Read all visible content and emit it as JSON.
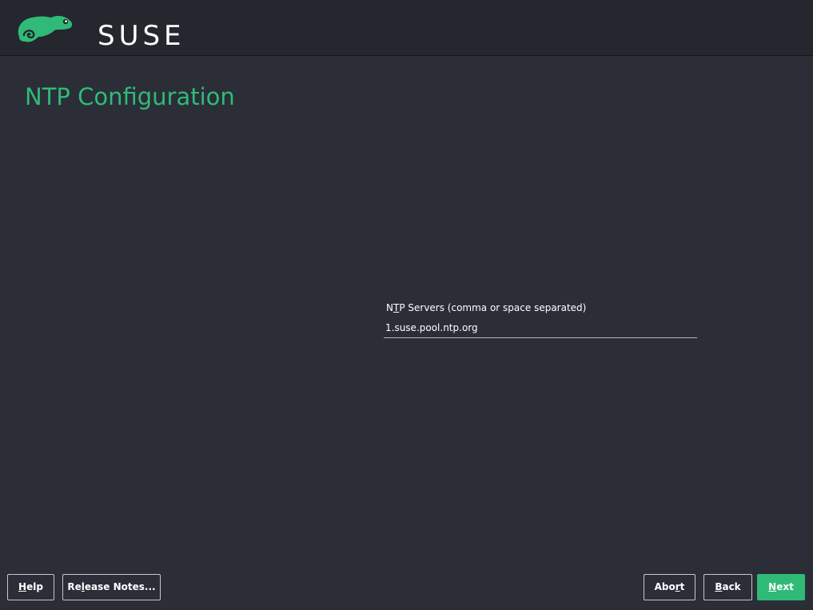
{
  "brand": {
    "name": "SUSE",
    "logo_color": "#30ba78"
  },
  "page": {
    "title": "NTP Configuration"
  },
  "ntp_field": {
    "label": "NTP Servers (comma or space separated)",
    "value": "1.suse.pool.ntp.org"
  },
  "buttons": {
    "help": "Help",
    "release_notes": "Release Notes...",
    "abort": "Abort",
    "back": "Back",
    "next": "Next"
  },
  "colors": {
    "accent": "#30ba78",
    "background": "#2b2e37",
    "header": "#24272e"
  }
}
